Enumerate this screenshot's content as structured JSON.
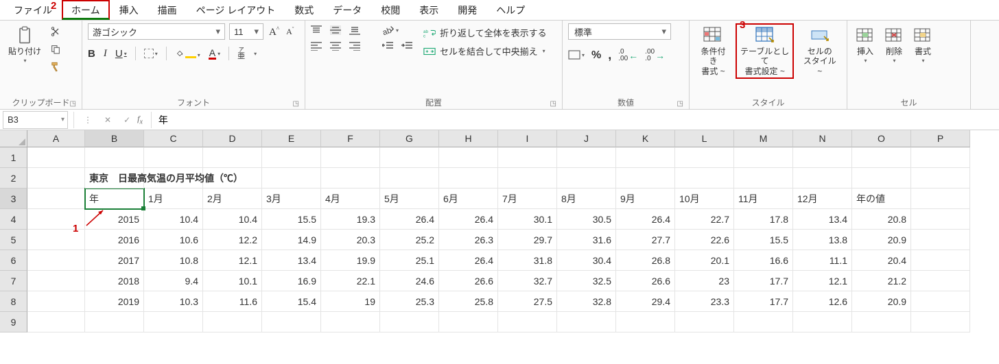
{
  "tabs": {
    "file": "ファイル",
    "home": "ホーム",
    "insert": "挿入",
    "draw": "描画",
    "pageLayout": "ページ レイアウト",
    "formulas": "数式",
    "data": "データ",
    "review": "校閲",
    "view": "表示",
    "developer": "開発",
    "help": "ヘルプ"
  },
  "ribbon": {
    "clipboard": {
      "label": "クリップボード",
      "paste": "貼り付け"
    },
    "font": {
      "label": "フォント",
      "name": "游ゴシック",
      "size": "11",
      "ruby_a": "ア",
      "ruby_sub": "亜"
    },
    "alignment": {
      "label": "配置",
      "wrap": "折り返して全体を表示する",
      "merge": "セルを結合して中央揃え"
    },
    "number": {
      "label": "数値",
      "format": "標準"
    },
    "styles": {
      "label": "スタイル",
      "cond": "条件付き\n書式 ~",
      "table": "テーブルとして\n書式設定 ~",
      "cell": "セルの\nスタイル ~"
    },
    "cells": {
      "label": "セル",
      "insert": "挿入",
      "delete": "削除",
      "format": "書式"
    }
  },
  "fbar": {
    "name": "B3",
    "formula": "年"
  },
  "anno": {
    "a1": "1",
    "a2": "2",
    "a3": "3"
  },
  "sheet": {
    "cols": [
      "A",
      "B",
      "C",
      "D",
      "E",
      "F",
      "G",
      "H",
      "I",
      "J",
      "K",
      "L",
      "M",
      "N",
      "O",
      "P"
    ],
    "rows": [
      "1",
      "2",
      "3",
      "4",
      "5",
      "6",
      "7",
      "8",
      "9"
    ],
    "title": "東京　日最高気温の月平均値（℃）",
    "headers": [
      "年",
      "1月",
      "2月",
      "3月",
      "4月",
      "5月",
      "6月",
      "7月",
      "8月",
      "9月",
      "10月",
      "11月",
      "12月",
      "年の値"
    ],
    "data": [
      [
        "2015",
        "10.4",
        "10.4",
        "15.5",
        "19.3",
        "26.4",
        "26.4",
        "30.1",
        "30.5",
        "26.4",
        "22.7",
        "17.8",
        "13.4",
        "20.8"
      ],
      [
        "2016",
        "10.6",
        "12.2",
        "14.9",
        "20.3",
        "25.2",
        "26.3",
        "29.7",
        "31.6",
        "27.7",
        "22.6",
        "15.5",
        "13.8",
        "20.9"
      ],
      [
        "2017",
        "10.8",
        "12.1",
        "13.4",
        "19.9",
        "25.1",
        "26.4",
        "31.8",
        "30.4",
        "26.8",
        "20.1",
        "16.6",
        "11.1",
        "20.4"
      ],
      [
        "2018",
        "9.4",
        "10.1",
        "16.9",
        "22.1",
        "24.6",
        "26.6",
        "32.7",
        "32.5",
        "26.6",
        "23",
        "17.7",
        "12.1",
        "21.2"
      ],
      [
        "2019",
        "10.3",
        "11.6",
        "15.4",
        "19",
        "25.3",
        "25.8",
        "27.5",
        "32.8",
        "29.4",
        "23.3",
        "17.7",
        "12.6",
        "20.9"
      ]
    ]
  }
}
